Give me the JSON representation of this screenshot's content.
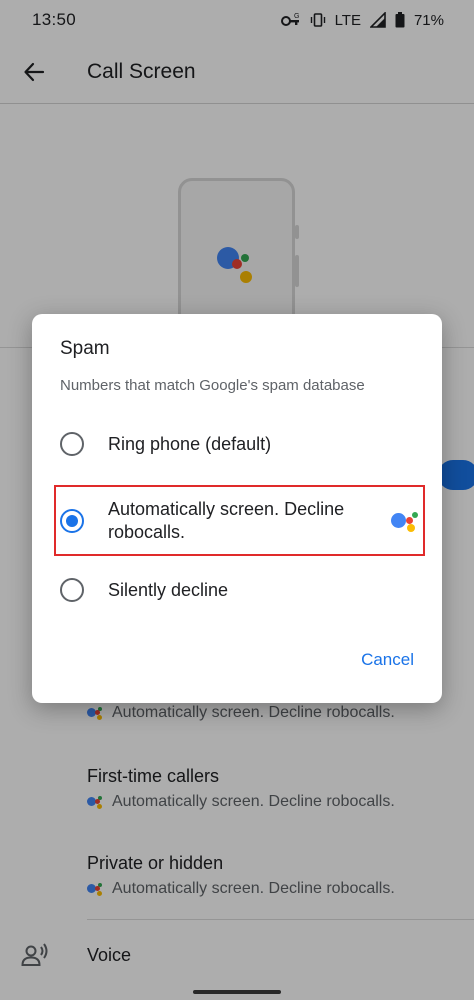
{
  "status_bar": {
    "time": "13:50",
    "network": "LTE",
    "battery": "71%"
  },
  "app_bar": {
    "title": "Call Screen"
  },
  "list": {
    "hidden_sub": "Automatically screen. Decline robocalls.",
    "items": [
      {
        "title": "First-time callers",
        "sub": "Automatically screen. Decline robocalls."
      },
      {
        "title": "Private or hidden",
        "sub": "Automatically screen. Decline robocalls."
      }
    ],
    "voice_label": "Voice"
  },
  "dialog": {
    "title": "Spam",
    "description": "Numbers that match Google's spam database",
    "options": [
      {
        "label": "Ring phone (default)",
        "selected": false
      },
      {
        "label": "Automatically screen. Decline robocalls.",
        "selected": true
      },
      {
        "label": "Silently decline",
        "selected": false
      }
    ],
    "cancel_label": "Cancel"
  },
  "colors": {
    "accent": "#1a73e8",
    "highlight": "#e02a2a",
    "assistant_blue": "#4285f4",
    "assistant_red": "#ea4335",
    "assistant_yellow": "#fbbc04",
    "assistant_green": "#34a853"
  },
  "icons": [
    "back-arrow-icon",
    "vpn-key-icon",
    "vibrate-icon",
    "signal-icon",
    "battery-icon",
    "google-assistant-icon",
    "voice-person-icon"
  ]
}
